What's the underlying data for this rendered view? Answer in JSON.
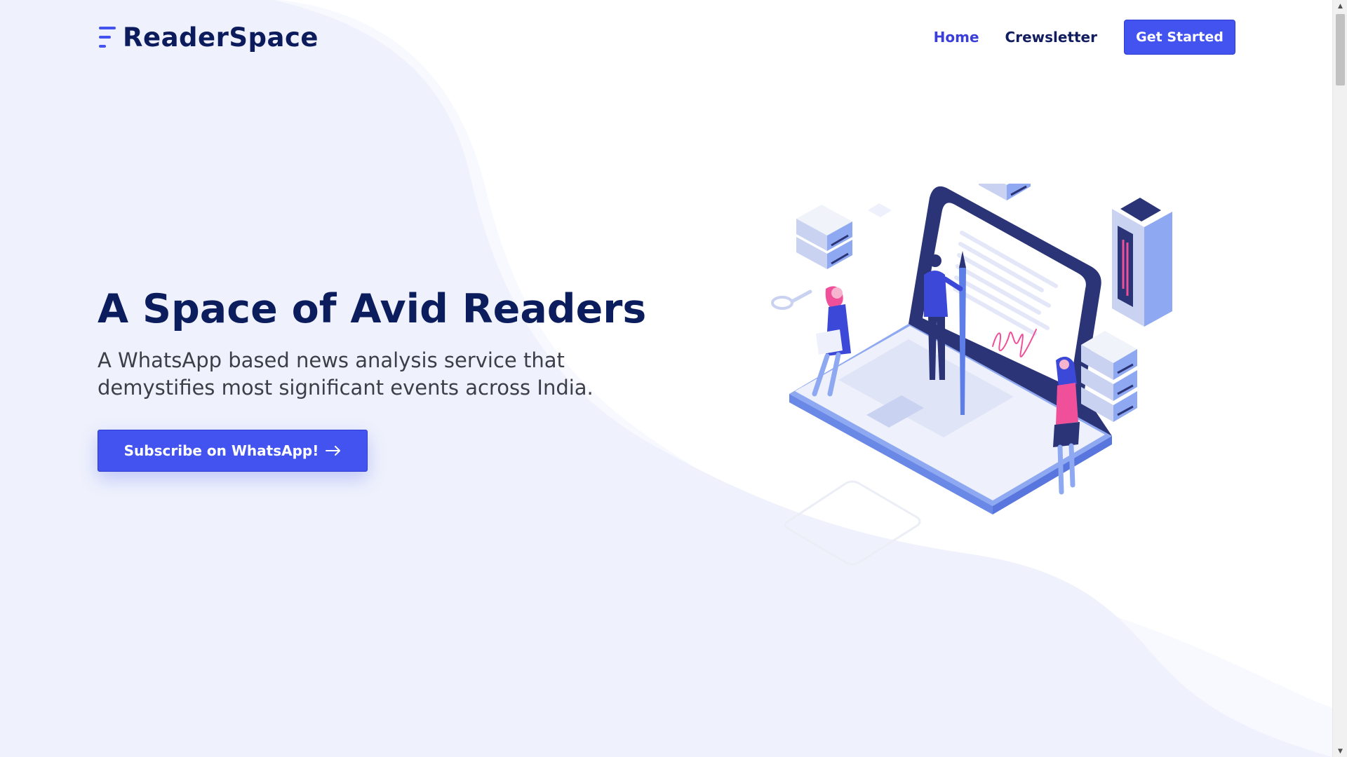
{
  "brand": {
    "name": "ReaderSpace"
  },
  "nav": {
    "links": [
      {
        "label": "Home",
        "active": true
      },
      {
        "label": "Crewsletter",
        "active": false
      }
    ],
    "cta_label": "Get Started"
  },
  "hero": {
    "title": "A Space of Avid Readers",
    "subtitle": "A WhatsApp based news analysis service that demystifies most significant events across India.",
    "cta_label": "Subscribe on WhatsApp!"
  },
  "colors": {
    "primary": "#4353f0",
    "heading": "#0c1d5e",
    "body_text": "#3c3f47",
    "background_wave": "#eef2fc",
    "accent_pink": "#f0509a"
  },
  "illustration": {
    "description_icons": [
      "laptop-icon",
      "server-icon",
      "key-icon",
      "pencil-icon",
      "signature-icon",
      "person-icon"
    ]
  }
}
